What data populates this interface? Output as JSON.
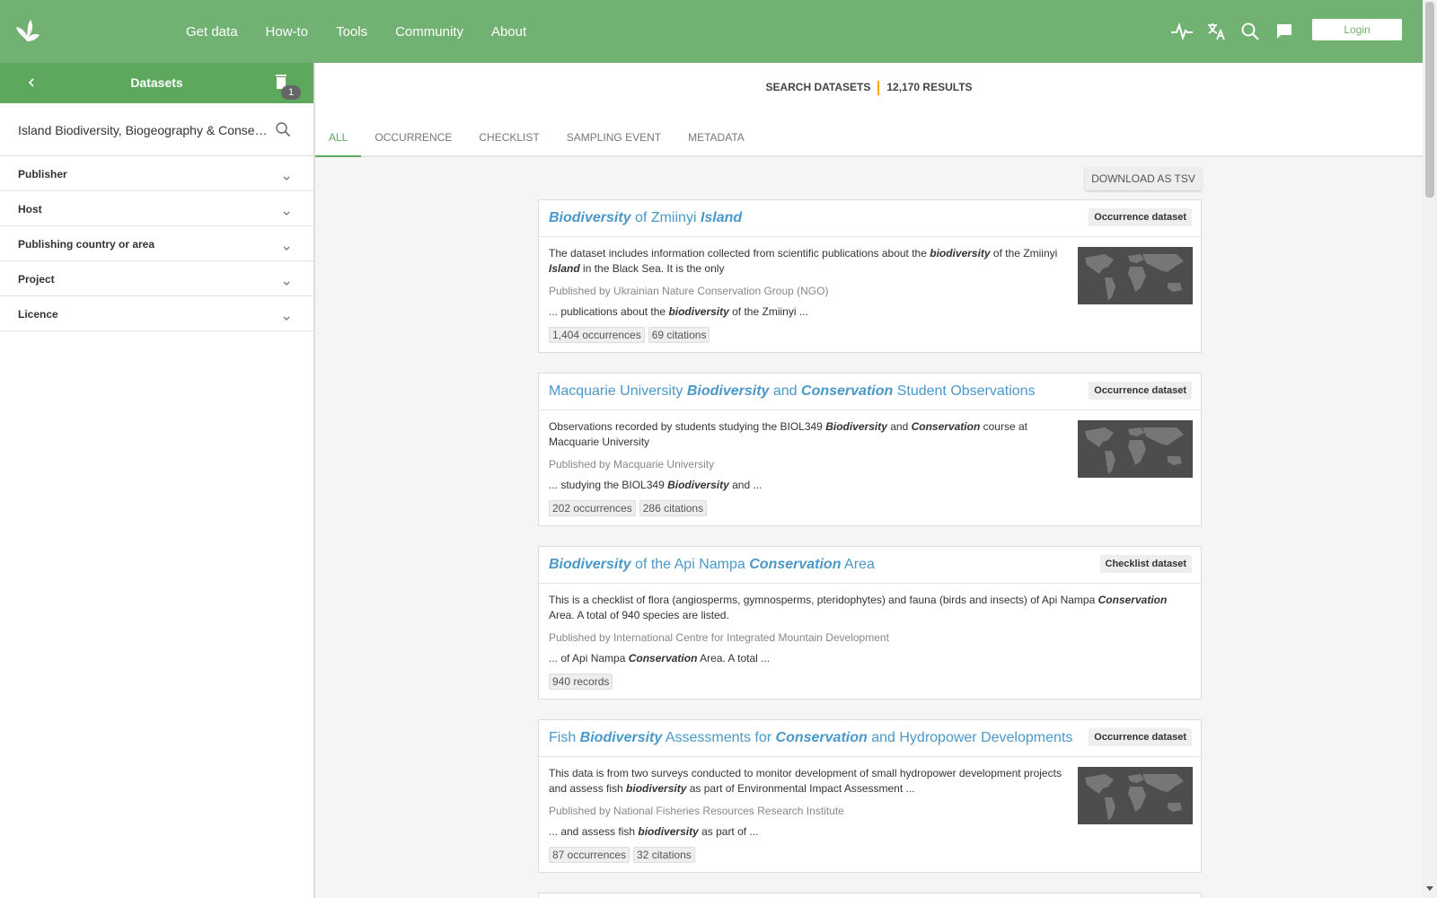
{
  "nav": {
    "items": [
      "Get data",
      "How-to",
      "Tools",
      "Community",
      "About"
    ],
    "login": "Login"
  },
  "topicons": [
    "activity-icon",
    "translate-icon",
    "search-icon",
    "feedback-icon"
  ],
  "sidebar": {
    "title": "Datasets",
    "badge": "1",
    "search_value": "Island Biodiversity, Biogeography & Conservation",
    "facets": [
      "Publisher",
      "Host",
      "Publishing country or area",
      "Project",
      "Licence"
    ]
  },
  "summary": {
    "label": "SEARCH DATASETS",
    "results": "12,170 RESULTS"
  },
  "tabs": [
    "ALL",
    "OCCURRENCE",
    "CHECKLIST",
    "SAMPLING EVENT",
    "METADATA"
  ],
  "download_label": "DOWNLOAD AS TSV",
  "results": [
    {
      "title_parts": [
        {
          "t": "Biodiversity",
          "b": true
        },
        {
          "t": " of Zmiinyi ",
          "b": false
        },
        {
          "t": "Island",
          "b": true
        }
      ],
      "type": "Occurrence dataset",
      "desc_parts": [
        {
          "t": "The dataset includes information collected from scientific publications about the ",
          "b": false
        },
        {
          "t": "biodiversity",
          "b": true
        },
        {
          "t": " of the Zmiinyi ",
          "b": false
        },
        {
          "t": "Island",
          "b": true
        },
        {
          "t": " in the Black Sea. It is the only",
          "b": false
        }
      ],
      "publisher": "Published by Ukrainian Nature Conservation Group (NGO)",
      "snippet_parts": [
        {
          "t": "... publications about the ",
          "b": false
        },
        {
          "t": "biodiversity",
          "b": true
        },
        {
          "t": " of the Zmiinyi ...",
          "b": false
        }
      ],
      "tags": [
        "1,404 occurrences",
        "69 citations"
      ],
      "has_map": true
    },
    {
      "title_parts": [
        {
          "t": "Macquarie University ",
          "b": false
        },
        {
          "t": "Biodiversity",
          "b": true
        },
        {
          "t": " and ",
          "b": false
        },
        {
          "t": "Conservation",
          "b": true
        },
        {
          "t": " Student Observations",
          "b": false
        }
      ],
      "type": "Occurrence dataset",
      "desc_parts": [
        {
          "t": "Observations recorded by students studying the BIOL349 ",
          "b": false
        },
        {
          "t": "Biodiversity",
          "b": true
        },
        {
          "t": " and ",
          "b": false
        },
        {
          "t": "Conservation",
          "b": true
        },
        {
          "t": " course at Macquarie University",
          "b": false
        }
      ],
      "publisher": "Published by Macquarie University",
      "snippet_parts": [
        {
          "t": "... studying the BIOL349 ",
          "b": false
        },
        {
          "t": "Biodiversity",
          "b": true
        },
        {
          "t": " and ...",
          "b": false
        }
      ],
      "tags": [
        "202 occurrences",
        "286 citations"
      ],
      "has_map": true
    },
    {
      "title_parts": [
        {
          "t": "Biodiversity",
          "b": true
        },
        {
          "t": " of the Api Nampa ",
          "b": false
        },
        {
          "t": "Conservation",
          "b": true
        },
        {
          "t": " Area",
          "b": false
        }
      ],
      "type": "Checklist dataset",
      "desc_parts": [
        {
          "t": "This is a checklist of flora (angiosperms, gymnosperms, pteridophytes) and fauna (birds and insects) of Api Nampa ",
          "b": false
        },
        {
          "t": "Conservation",
          "b": true
        },
        {
          "t": " Area. A total of 940 species are listed.",
          "b": false
        }
      ],
      "publisher": "Published by International Centre for Integrated Mountain Development",
      "snippet_parts": [
        {
          "t": "... of Api Nampa ",
          "b": false
        },
        {
          "t": "Conservation",
          "b": true
        },
        {
          "t": " Area. A total ...",
          "b": false
        }
      ],
      "tags": [
        "940 records"
      ],
      "has_map": false
    },
    {
      "title_parts": [
        {
          "t": "Fish ",
          "b": false
        },
        {
          "t": "Biodiversity",
          "b": true
        },
        {
          "t": " Assessments for ",
          "b": false
        },
        {
          "t": "Conservation",
          "b": true
        },
        {
          "t": " and Hydropower Developments",
          "b": false
        }
      ],
      "type": "Occurrence dataset",
      "desc_parts": [
        {
          "t": "This data is from two surveys conducted to monitor development of small hydropower development projects and assess fish ",
          "b": false
        },
        {
          "t": "biodiversity",
          "b": true
        },
        {
          "t": " as part of Environmental Impact Assessment ...",
          "b": false
        }
      ],
      "publisher": "Published by National Fisheries Resources Research Institute",
      "snippet_parts": [
        {
          "t": "... and assess fish ",
          "b": false
        },
        {
          "t": "biodiversity",
          "b": true
        },
        {
          "t": " as part of ...",
          "b": false
        }
      ],
      "tags": [
        "87 occurrences",
        "32 citations"
      ],
      "has_map": true
    }
  ]
}
